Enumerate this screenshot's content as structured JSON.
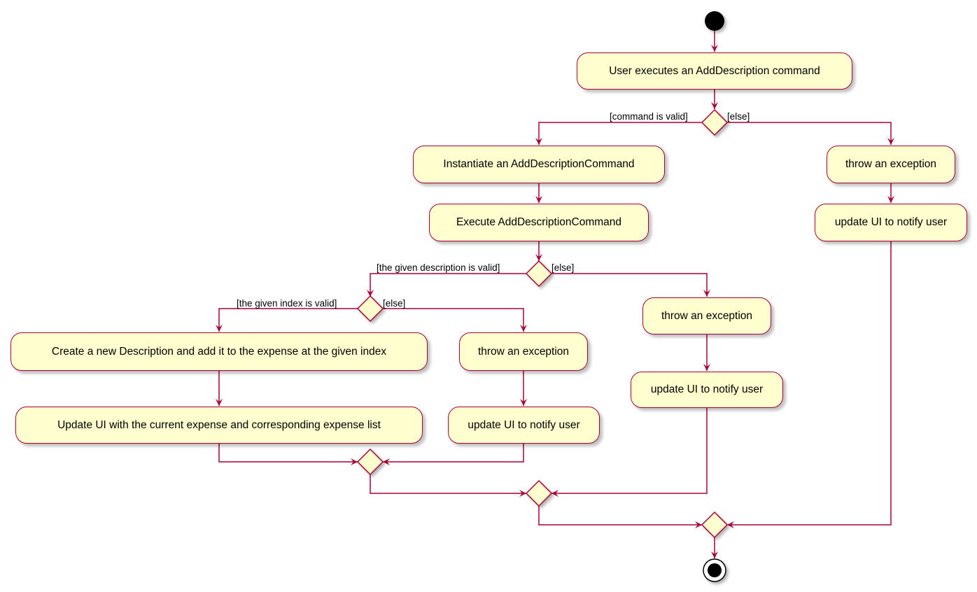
{
  "diagram": {
    "type": "activity",
    "colors": {
      "line": "#a80036",
      "fill": "#fefece",
      "node_fill": "#000000"
    },
    "activities": {
      "user_executes": "User executes an AddDescription command",
      "instantiate": "Instantiate an AddDescriptionCommand",
      "execute": "Execute AddDescriptionCommand",
      "create_description": "Create a new Description and add it to the expense at the given index",
      "update_ui_list": "Update UI with the current expense and corresponding expense list",
      "throw_index": "throw an exception",
      "notify_index": "update UI to notify user",
      "throw_desc": "throw an exception",
      "notify_desc": "update UI to notify user",
      "throw_cmd": "throw an exception",
      "notify_cmd": "update UI to notify user"
    },
    "guards": {
      "command_valid": "[command is valid]",
      "command_else": "[else]",
      "desc_valid": "[the given description is valid]",
      "desc_else": "[else]",
      "index_valid": "[the given index is valid]",
      "index_else": "[else]"
    }
  }
}
